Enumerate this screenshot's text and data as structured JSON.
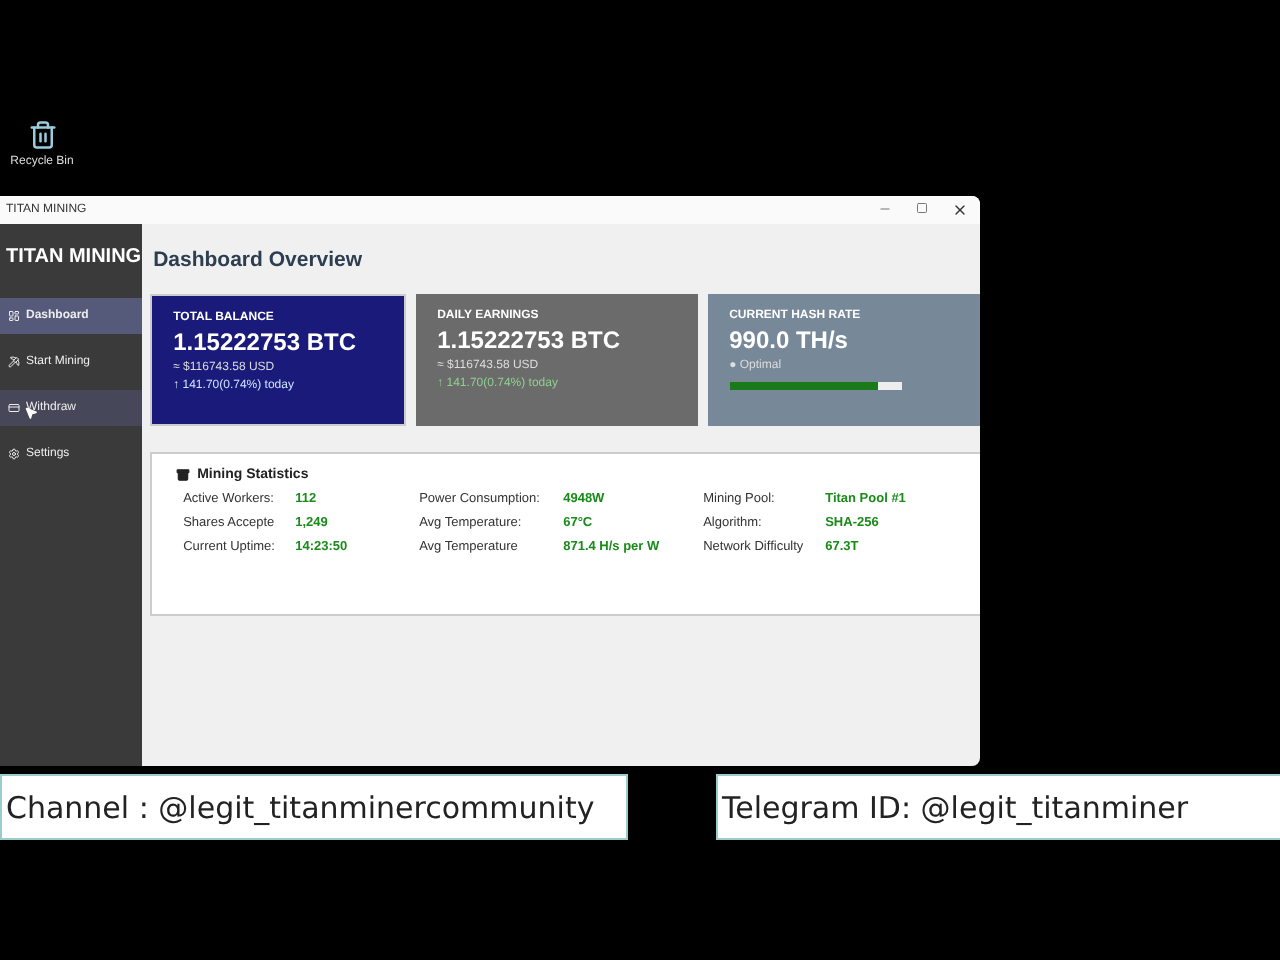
{
  "desktop": {
    "icons": [
      {
        "label": "Recycle Bin"
      }
    ]
  },
  "window": {
    "title": "TITAN MINING"
  },
  "sidebar": {
    "title": "TITAN MINING",
    "items": [
      {
        "label": "Dashboard",
        "kind": "dashboard",
        "selected": true,
        "hovered": false
      },
      {
        "label": "Start Mining",
        "kind": "mining",
        "selected": false,
        "hovered": false
      },
      {
        "label": "Withdraw",
        "kind": "withdraw",
        "selected": false,
        "hovered": true
      },
      {
        "label": "Settings",
        "kind": "settings",
        "selected": false,
        "hovered": false
      }
    ]
  },
  "header": "Dashboard Overview",
  "cards": [
    {
      "kind": "balance",
      "title": "TOTAL BALANCE",
      "value": "1.15222753 BTC",
      "usd": "≈ $116743.58 USD",
      "change": "↑ 141.70(0.74%) today"
    },
    {
      "kind": "earnings",
      "title": "DAILY EARNINGS",
      "value": "1.15222753 BTC",
      "usd": "≈ $116743.58 USD",
      "change": "↑ 141.70(0.74%) today"
    },
    {
      "kind": "hashrate",
      "title": "CURRENT HASH RATE",
      "value": "990.0 TH/s",
      "status": "● Optimal",
      "level": 0.86
    }
  ],
  "statistics": {
    "title": "Mining Statistics",
    "columns": [
      [
        {
          "label": "Active Workers:",
          "value": "112"
        },
        {
          "label": "Shares Accepte",
          "value": "1,249"
        },
        {
          "label": "Current Uptime:",
          "value": "14:23:50"
        }
      ],
      [
        {
          "label": "Power Consumption:",
          "value": "4948W"
        },
        {
          "label": "Avg Temperature:",
          "value": "67°C"
        },
        {
          "label": "Avg Temperature",
          "value": "871.4 H/s per W"
        }
      ],
      [
        {
          "label": "Mining Pool:",
          "value": "Titan Pool #1"
        },
        {
          "label": "Algorithm:",
          "value": "SHA-256"
        },
        {
          "label": "Network Difficulty",
          "value": "67.3T"
        }
      ]
    ]
  },
  "banners": [
    "Channel : @legit_titanminercommunity",
    "Telegram ID: @legit_titanminer"
  ]
}
